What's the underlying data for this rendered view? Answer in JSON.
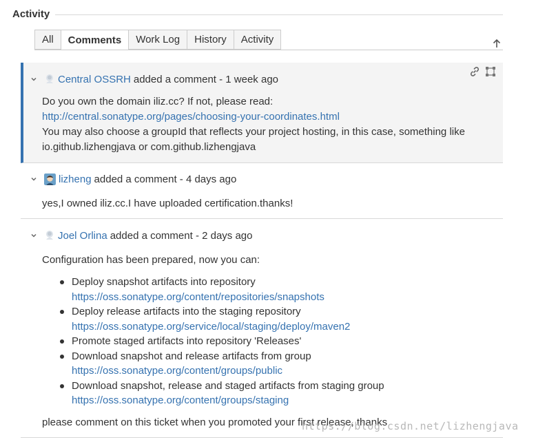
{
  "section": {
    "title": "Activity"
  },
  "tabs": [
    {
      "label": "All",
      "active": false
    },
    {
      "label": "Comments",
      "active": true
    },
    {
      "label": "Work Log",
      "active": false
    },
    {
      "label": "History",
      "active": false
    },
    {
      "label": "Activity",
      "active": false
    }
  ],
  "comments": [
    {
      "author": "Central OSSRH",
      "meta": "added a comment - 1 week ago",
      "lines": {
        "l1": "Do you own the domain iliz.cc? If not, please read:",
        "link": "http://central.sonatype.org/pages/choosing-your-coordinates.html",
        "l3": "You may also choose a groupId that reflects your project hosting, in this case, something like",
        "l4": "io.github.lizhengjava or com.github.lizhengjava"
      }
    },
    {
      "author": "lizheng",
      "meta": "added a comment - 4 days ago",
      "lines": {
        "l1": "yes,I owned iliz.cc.I have uploaded certification.thanks!"
      }
    },
    {
      "author": "Joel Orlina",
      "meta": "added a comment - 2 days ago",
      "intro": "Configuration has been prepared, now you can:",
      "steps": [
        {
          "text": "Deploy snapshot artifacts into repository",
          "url": "https://oss.sonatype.org/content/repositories/snapshots"
        },
        {
          "text": "Deploy release artifacts into the staging repository",
          "url": "https://oss.sonatype.org/service/local/staging/deploy/maven2"
        },
        {
          "text": "Promote staged artifacts into repository 'Releases'",
          "url": ""
        },
        {
          "text": "Download snapshot and release artifacts from group",
          "url": "https://oss.sonatype.org/content/groups/public"
        },
        {
          "text": "Download snapshot, release and staged artifacts from staging group",
          "url": "https://oss.sonatype.org/content/groups/staging"
        }
      ],
      "outro": "please comment on this ticket when you promoted your first release, thanks"
    }
  ],
  "watermark": "https://blog.csdn.net/lizhengjava",
  "colors": {
    "link": "#3572b0",
    "focus_bar": "#3572b0",
    "focus_bg": "#f4f4f4"
  }
}
